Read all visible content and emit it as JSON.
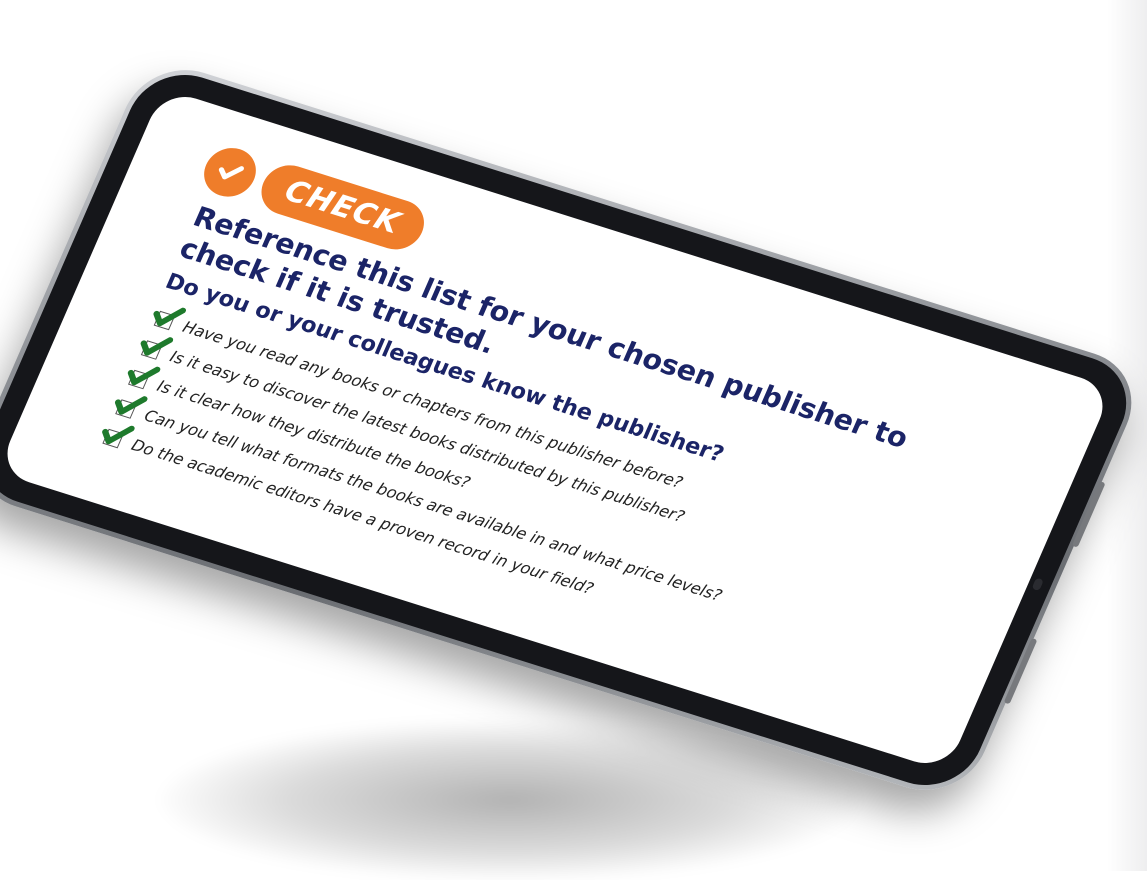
{
  "badge": {
    "label": "CHECK",
    "color": "#ef7d2a"
  },
  "heading": "Reference this list for your chosen publisher to check if it is trusted.",
  "question": "Do you or your colleagues know the publisher?",
  "checklist": [
    "Have you read any books or chapters from this publisher before?",
    "Is it easy to discover the latest books distributed by this publisher?",
    "Is it clear how they distribute the books?",
    "Can you tell what formats the books are available in and what price levels?",
    "Do the academic editors have a proven record in your field?"
  ],
  "colors": {
    "heading": "#1b2467",
    "tick": "#1e7a2c"
  },
  "icons": [
    "check-circle-icon",
    "checkmark-icon"
  ]
}
